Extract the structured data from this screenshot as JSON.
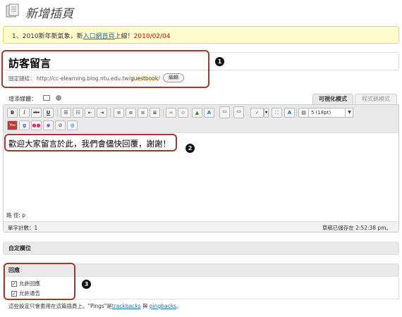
{
  "header": {
    "title": "新增插頁"
  },
  "notice": {
    "prefix": "1、2010新年新氣象，新",
    "link": "入口網首頁",
    "suffix": "上線！",
    "date": "2010/02/04"
  },
  "post": {
    "title": "訪客留言",
    "permalink_label": "固定鏈結：",
    "permalink_base": "http://cc-elearning.blog.ntu.edu.tw/",
    "permalink_slug": "guestbook",
    "permalink_tail": "/",
    "edit_button": "編輯"
  },
  "media": {
    "label": "增添媒體："
  },
  "editor": {
    "tab_visual": "可視化模式",
    "tab_html": "程式碼模式",
    "font_size": "5 (18pt)",
    "content": "歡迎大家留言於此，我們會儘快回覆，謝謝！",
    "path": "路  徑: p",
    "word_count": "單字計數：1",
    "draft_saved": "草稿已儲存在 2:52:38 pm。"
  },
  "panels": {
    "custom_fields": "自定欄位",
    "discussion": "回應",
    "allow_comments": "允許回應",
    "allow_pings": "允許通告",
    "footnote_prefix": "這些設定只會套用在這篇插頁上。\"Pings\"是",
    "footnote_link1": "trackbacks",
    "footnote_and": " 與 ",
    "footnote_link2": "pingbacks",
    "footnote_suffix": "。"
  },
  "markers": [
    "1",
    "2",
    "3"
  ],
  "colors": {
    "callout": "#a03a2d",
    "link": "#21759b",
    "date": "#dd0000"
  }
}
